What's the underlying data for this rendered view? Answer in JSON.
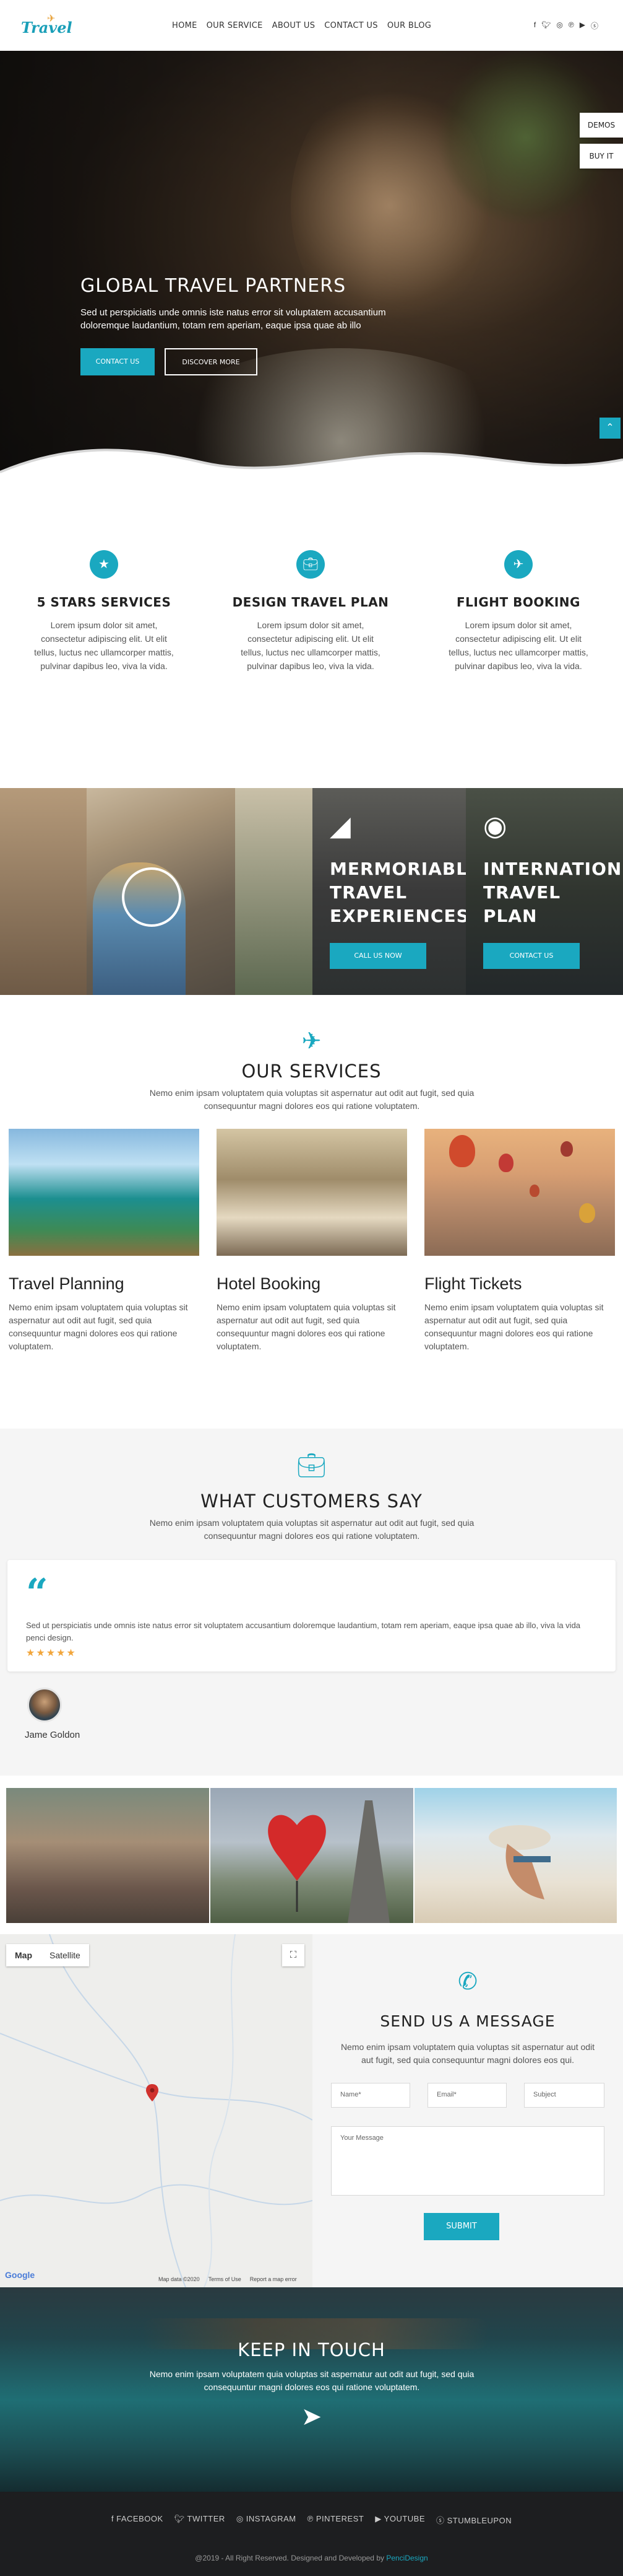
{
  "header": {
    "logo_text": "Travel",
    "nav": [
      "HOME",
      "OUR SERVICE",
      "ABOUT US",
      "CONTACT US",
      "OUR BLOG"
    ],
    "social_icons": [
      "facebook-icon",
      "twitter-icon",
      "instagram-icon",
      "pinterest-icon",
      "youtube-icon",
      "stumbleupon-icon"
    ]
  },
  "hero": {
    "title": "GLOBAL TRAVEL PARTNERS",
    "text": "Sed ut perspiciatis unde omnis iste natus error sit voluptatem accusantium doloremque laudantium, totam rem aperiam, eaque ipsa quae ab illo",
    "btn_contact": "CONTACT US",
    "btn_discover": "DISCOVER MORE",
    "side_demos": "DEMOS",
    "side_buy": "BUY IT"
  },
  "features": [
    {
      "icon": "star-icon",
      "title": "5 STARS SERVICES",
      "text": "Lorem ipsum dolor sit amet, consectetur adipiscing elit. Ut elit tellus, luctus nec ullamcorper mattis, pulvinar dapibus leo, viva la vida."
    },
    {
      "icon": "suitcase-icon",
      "title": "DESIGN TRAVEL PLAN",
      "text": "Lorem ipsum dolor sit amet, consectetur adipiscing elit. Ut elit tellus, luctus nec ullamcorper mattis, pulvinar dapibus leo, viva la vida."
    },
    {
      "icon": "plane-icon",
      "title": "FLIGHT BOOKING",
      "text": "Lorem ipsum dolor sit amet, consectetur adipiscing elit. Ut elit tellus, luctus nec ullamcorper mattis, pulvinar dapibus leo, viva la vida."
    }
  ],
  "banner": {
    "panel1_title": "MERMORIABL TRAVEL EXPERIENCES",
    "panel1_line1": "MERMORIABL",
    "panel1_line2": "TRAVEL",
    "panel1_line3": "EXPERIENCES",
    "panel1_btn": "CALL US NOW",
    "panel2_line1": "INTERNATION",
    "panel2_line2": "TRAVEL",
    "panel2_line3": "PLAN",
    "panel2_btn": "CONTACT US"
  },
  "services": {
    "title": "OUR SERVICES",
    "subtitle": "Nemo enim ipsam voluptatem quia voluptas sit aspernatur aut odit aut fugit, sed quia consequuntur magni dolores eos qui ratione voluptatem.",
    "cards": [
      {
        "title": "Travel Planning",
        "text": "Nemo enim ipsam voluptatem quia voluptas sit aspernatur aut odit aut fugit, sed quia consequuntur magni dolores eos qui ratione voluptatem."
      },
      {
        "title": "Hotel Booking",
        "text": "Nemo enim ipsam voluptatem quia voluptas sit aspernatur aut odit aut fugit, sed quia consequuntur magni dolores eos qui ratione voluptatem."
      },
      {
        "title": "Flight Tickets",
        "text": "Nemo enim ipsam voluptatem quia voluptas sit aspernatur aut odit aut fugit, sed quia consequuntur magni dolores eos qui ratione voluptatem."
      }
    ]
  },
  "testimonials": {
    "title": "WHAT CUSTOMERS SAY",
    "subtitle": "Nemo enim ipsam voluptatem quia voluptas sit aspernatur aut odit aut fugit, sed quia consequuntur magni dolores eos qui ratione voluptatem.",
    "quote": "Sed ut perspiciatis unde omnis iste natus error sit voluptatem accusantium doloremque laudantium, totam rem aperiam, eaque ipsa quae ab illo, viva la vida penci design.",
    "stars": "★★★★★",
    "rating": 5,
    "name": "Jame Goldon"
  },
  "map": {
    "tab_map": "Map",
    "tab_satellite": "Satellite",
    "google": "Google",
    "footer": [
      "Map data ©2020",
      "Terms of Use",
      "Report a map error"
    ]
  },
  "contact": {
    "title": "SEND US A MESSAGE",
    "subtitle": "Nemo enim ipsam voluptatem quia voluptas sit aspernatur aut odit aut fugit, sed quia consequuntur magni dolores eos qui.",
    "name_placeholder": "Name*",
    "email_placeholder": "Email*",
    "subject_placeholder": "Subject",
    "message_placeholder": "Your Message",
    "submit": "SUBMIT"
  },
  "keep_in_touch": {
    "title": "KEEP IN TOUCH",
    "text": "Nemo enim ipsam voluptatem quia voluptas sit aspernatur aut odit aut fugit, sed quia consequuntur magni dolores eos qui ratione voluptatem."
  },
  "footer": {
    "links": [
      "FACEBOOK",
      "TWITTER",
      "INSTAGRAM",
      "PINTEREST",
      "YOUTUBE",
      "STUMBLEUPON"
    ],
    "copyright": "@2019 - All Right Reserved. Designed and Developed by ",
    "brand": "PenciDesign"
  },
  "colors": {
    "accent": "#1aa8c0",
    "star": "#f2a63c",
    "footer_bg": "#1d1e20"
  }
}
